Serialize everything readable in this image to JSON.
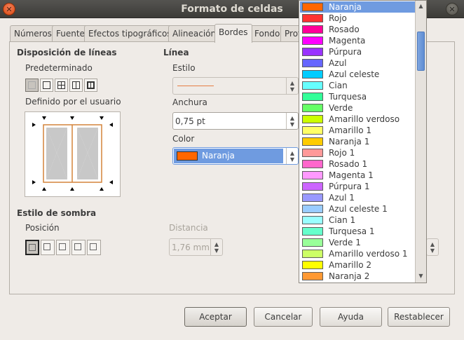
{
  "window": {
    "title": "Formato de celdas"
  },
  "tabs": [
    {
      "label": "Números"
    },
    {
      "label": "Fuente"
    },
    {
      "label": "Efectos tipográficos"
    },
    {
      "label": "Alineación"
    },
    {
      "label": "Bordes"
    },
    {
      "label": "Fondo"
    },
    {
      "label": "Prot"
    }
  ],
  "active_tab": "Bordes",
  "line_arrangement": {
    "heading": "Disposición de líneas",
    "default_label": "Predeterminado",
    "user_defined_label": "Definido por el usuario"
  },
  "line": {
    "heading": "Línea",
    "style_label": "Estilo",
    "width_label": "Anchura",
    "width_value": "0,75 pt",
    "color_label": "Color",
    "color_value": "Naranja",
    "color_swatch": "#ff6600"
  },
  "shadow": {
    "heading": "Estilo de sombra",
    "position_label": "Posición",
    "distance_label": "Distancia",
    "distance_value": "1,76 mm"
  },
  "buttons": {
    "ok": "Aceptar",
    "cancel": "Cancelar",
    "help": "Ayuda",
    "reset": "Restablecer"
  },
  "color_list": [
    {
      "name": "Naranja",
      "color": "#ff6600",
      "selected": true
    },
    {
      "name": "Rojo",
      "color": "#ff3333"
    },
    {
      "name": "Rosado",
      "color": "#ff0099"
    },
    {
      "name": "Magenta",
      "color": "#ff00ff"
    },
    {
      "name": "Púrpura",
      "color": "#9933ff"
    },
    {
      "name": "Azul",
      "color": "#6666ff"
    },
    {
      "name": "Azul celeste",
      "color": "#00ccff"
    },
    {
      "name": "Cian",
      "color": "#66ffff"
    },
    {
      "name": "Turquesa",
      "color": "#33ff99"
    },
    {
      "name": "Verde",
      "color": "#66ff66"
    },
    {
      "name": "Amarillo verdoso",
      "color": "#ccff00"
    },
    {
      "name": "Amarillo 1",
      "color": "#ffff66"
    },
    {
      "name": "Naranja 1",
      "color": "#ffcc00"
    },
    {
      "name": "Rojo 1",
      "color": "#ff9999"
    },
    {
      "name": "Rosado 1",
      "color": "#ff66cc"
    },
    {
      "name": "Magenta 1",
      "color": "#ff99ff"
    },
    {
      "name": "Púrpura 1",
      "color": "#cc66ff"
    },
    {
      "name": "Azul 1",
      "color": "#9999ff"
    },
    {
      "name": "Azul celeste 1",
      "color": "#99ccff"
    },
    {
      "name": "Cian 1",
      "color": "#99ffff"
    },
    {
      "name": "Turquesa 1",
      "color": "#66ffcc"
    },
    {
      "name": "Verde 1",
      "color": "#99ff99"
    },
    {
      "name": "Amarillo verdoso 1",
      "color": "#ccff66"
    },
    {
      "name": "Amarillo 2",
      "color": "#ffff00"
    },
    {
      "name": "Naranja 2",
      "color": "#ff9933"
    }
  ]
}
